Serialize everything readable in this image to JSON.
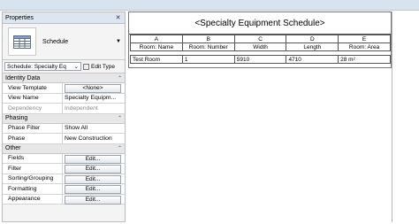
{
  "properties": {
    "title": "Properties",
    "close_icon": "✕",
    "type_name": "Schedule",
    "instance_selector": "Schedule: Specialty Eq",
    "edit_type": "Edit Type",
    "groups": [
      {
        "label": "Identity Data",
        "rows": [
          {
            "name": "View Template",
            "value": "<None>",
            "kind": "button"
          },
          {
            "name": "View Name",
            "value": "Specialty Equipm...",
            "kind": "text"
          },
          {
            "name": "Dependency",
            "value": "Independent",
            "kind": "dim"
          }
        ]
      },
      {
        "label": "Phasing",
        "rows": [
          {
            "name": "Phase Filter",
            "value": "Show All",
            "kind": "text"
          },
          {
            "name": "Phase",
            "value": "New Construction",
            "kind": "text"
          }
        ]
      },
      {
        "label": "Other",
        "rows": [
          {
            "name": "Fields",
            "value": "Edit...",
            "kind": "button"
          },
          {
            "name": "Filter",
            "value": "Edit...",
            "kind": "button"
          },
          {
            "name": "Sorting/Grouping",
            "value": "Edit...",
            "kind": "button"
          },
          {
            "name": "Formatting",
            "value": "Edit...",
            "kind": "button"
          },
          {
            "name": "Appearance",
            "value": "Edit...",
            "kind": "button"
          }
        ]
      }
    ]
  },
  "schedule": {
    "title": "<Specialty Equipment Schedule>",
    "letters": [
      "A",
      "B",
      "C",
      "D",
      "E"
    ],
    "headers": [
      "Room: Name",
      "Room: Number",
      "Width",
      "Length",
      "Room: Area"
    ],
    "rows": [
      [
        "Test Room",
        "1",
        "5910",
        "4710",
        "28 m²"
      ]
    ]
  }
}
